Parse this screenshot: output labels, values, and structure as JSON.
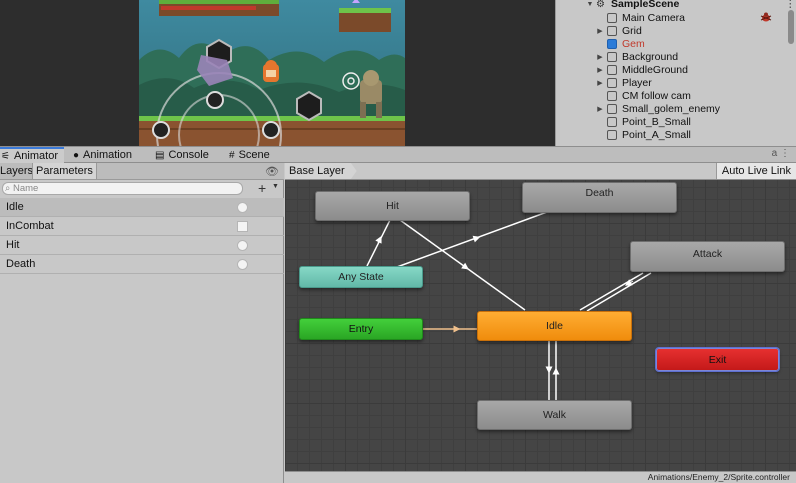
{
  "hierarchy": {
    "scene": "SampleScene",
    "items": [
      {
        "label": "Main Camera",
        "expandable": false,
        "color": "#111111"
      },
      {
        "label": "Grid",
        "expandable": true,
        "color": "#111111"
      },
      {
        "label": "Gem",
        "expandable": false,
        "color": "#c0392b"
      },
      {
        "label": "Background",
        "expandable": true,
        "color": "#111111"
      },
      {
        "label": "MiddleGround",
        "expandable": true,
        "color": "#111111"
      },
      {
        "label": "Player",
        "expandable": true,
        "color": "#111111"
      },
      {
        "label": "CM follow cam",
        "expandable": false,
        "color": "#111111"
      },
      {
        "label": "Small_golem_enemy",
        "expandable": true,
        "color": "#111111"
      },
      {
        "label": "Point_B_Small",
        "expandable": false,
        "color": "#111111"
      },
      {
        "label": "Point_A_Small",
        "expandable": false,
        "color": "#111111"
      }
    ]
  },
  "tabs": [
    {
      "label": "Animator",
      "icon": "animator-icon",
      "active": true
    },
    {
      "label": "Animation",
      "icon": "animation-icon",
      "active": false
    },
    {
      "label": "Console",
      "icon": "console-icon",
      "active": false
    },
    {
      "label": "Scene",
      "icon": "scene-icon",
      "active": false
    }
  ],
  "left_panel": {
    "tabs": [
      "Layers",
      "Parameters"
    ],
    "search_placeholder": "Name",
    "add_label": "+",
    "params": [
      {
        "name": "Idle",
        "kind": "trigger",
        "selected": true
      },
      {
        "name": "InCombat",
        "kind": "bool",
        "selected": false
      },
      {
        "name": "Hit",
        "kind": "trigger",
        "selected": false
      },
      {
        "name": "Death",
        "kind": "trigger",
        "selected": false
      }
    ]
  },
  "graph": {
    "layer": "Base Layer",
    "auto_live_link": "Auto Live Link",
    "status_path": "Animations/Enemy_2/Sprite.controller",
    "states": {
      "hit": "Hit",
      "death": "Death",
      "attack": "Attack",
      "any_state": "Any State",
      "entry": "Entry",
      "idle": "Idle",
      "exit": "Exit",
      "walk": "Walk"
    }
  },
  "colors": {
    "accent": "#3a79d8",
    "idle_node": "#f29b1b",
    "entry_node": "#33bd2c",
    "exit_node": "#d52424",
    "any_state_node": "#78c9b9",
    "default_transition": "#f0c08c"
  }
}
